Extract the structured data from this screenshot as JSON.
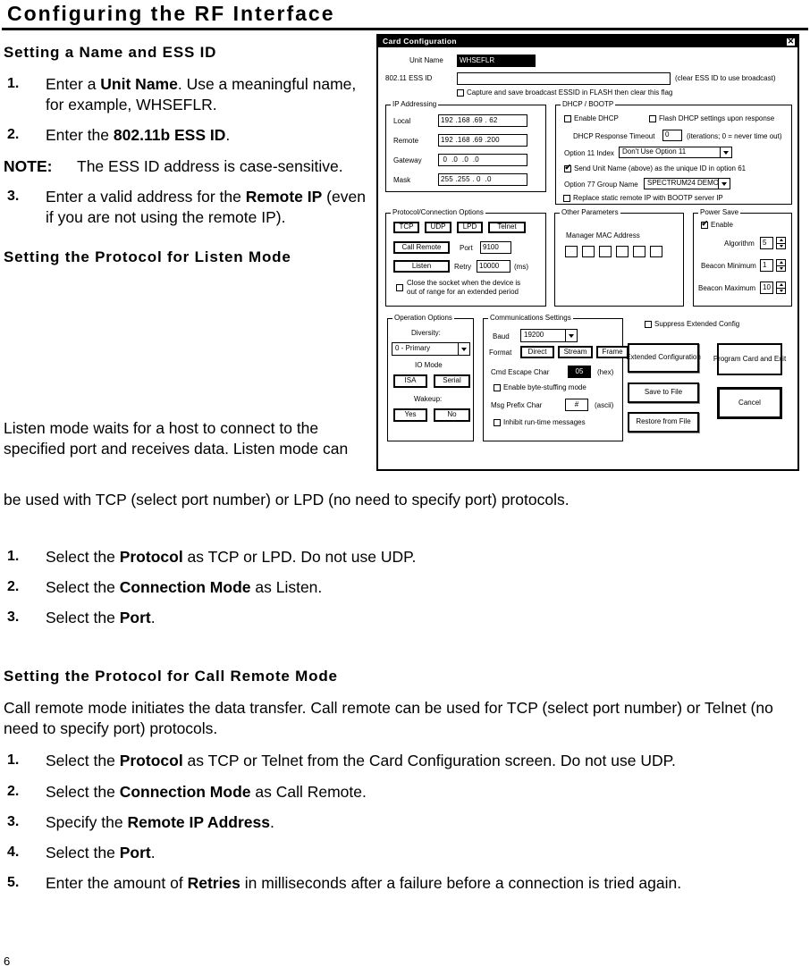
{
  "document": {
    "title": "Configuring the RF Interface",
    "page_number": "6"
  },
  "sections": [
    {
      "heading": "Setting a Name and ESS ID",
      "steps_html": [
        "Enter a <b>Unit Name</b>.  Use a meaningful name, for example, WHSEFLR.",
        "Enter the <b>802.11b ESS ID</b>."
      ],
      "note": {
        "label": "NOTE:",
        "text": "The ESS ID address is case-sensitive."
      },
      "steps_after_note_html": [
        "Enter a valid address for the <b>Remote IP</b> (even if you are not using the remote IP)."
      ]
    },
    {
      "heading": "Setting the Protocol for Listen Mode",
      "paragraph": "Listen mode waits for a host to connect to the specified port and receives data.  Listen mode can be used with TCP (select port number) or LPD (no need to specify port) protocols.",
      "steps_html": [
        "Select the <b>Protocol</b> as TCP or LPD.  Do not use UDP.",
        "Select the <b>Connection Mode</b> as Listen.",
        "Select the <b>Port</b>."
      ]
    },
    {
      "heading": "Setting the Protocol for Call Remote Mode",
      "paragraph": "Call remote mode initiates the data transfer.  Call remote can be used for TCP (select port number) or Telnet (no need to specify port) protocols.",
      "steps_html": [
        "Select the <b>Protocol</b> as TCP or Telnet from the Card Configuration screen.  Do not use UDP.",
        "Select the <b>Connection Mode</b> as Call Remote.",
        "Specify the <b>Remote IP Address</b>.",
        "Select the <b>Port</b>.",
        "Enter the amount of <b>Retries</b> in milliseconds after a failure before a connection is tried again."
      ]
    }
  ],
  "dialog": {
    "title": "Card Configuration",
    "close_label": "✕",
    "unit_name": {
      "label": "Unit Name",
      "value": "WHSEFLR"
    },
    "ess_id": {
      "label": "802.11 ESS ID",
      "value": "",
      "hint": "(clear ESS ID to use broadcast)",
      "capture_checkbox": {
        "label": "Capture and save broadcast ESSID in FLASH then clear this flag",
        "checked": false
      }
    },
    "ip_addressing": {
      "caption": "IP Addressing",
      "rows": [
        {
          "label": "Local",
          "octets": [
            "192",
            "168",
            "69",
            "62"
          ]
        },
        {
          "label": "Remote",
          "octets": [
            "192",
            "168",
            "69",
            "200"
          ]
        },
        {
          "label": "Gateway",
          "octets": [
            "0",
            "0",
            "0",
            "0"
          ]
        },
        {
          "label": "Mask",
          "octets": [
            "255",
            "255",
            "0",
            "0"
          ]
        }
      ]
    },
    "dhcp_bootp": {
      "caption": "DHCP / BOOTP",
      "enable_dhcp": {
        "label": "Enable DHCP",
        "checked": false
      },
      "flash_dhcp": {
        "label": "Flash DHCP settings upon response",
        "checked": false
      },
      "response_timeout": {
        "label": "DHCP Response Timeout",
        "value": "0",
        "suffix": "(iterations; 0 = never time out)"
      },
      "option11": {
        "label": "Option 11 Index",
        "value": "Don't Use Option 11"
      },
      "send_unit_name": {
        "label": "Send Unit Name (above) as the unique ID in option 61",
        "checked": true
      },
      "option77": {
        "label": "Option 77 Group Name",
        "value": "SPECTRUM24 DEMO"
      },
      "replace_static": {
        "label": "Replace static remote IP with BOOTP server IP",
        "checked": false
      }
    },
    "protocol_connection": {
      "caption": "Protocol/Connection Options",
      "protocols": [
        "TCP",
        "UDP",
        "LPD",
        "Telnet"
      ],
      "selected_protocol": "TCP",
      "mode_buttons": [
        "Call Remote",
        "Listen"
      ],
      "port": {
        "label": "Port",
        "value": "9100"
      },
      "retry": {
        "label": "Retry",
        "value": "10000",
        "units": "(ms)"
      },
      "close_socket": {
        "label": "Close the socket when the device is out of range for an extended period",
        "checked": false
      }
    },
    "other_parameters": {
      "caption": "Other Parameters",
      "mac_label": "Manager MAC Address",
      "mac_octets": [
        "",
        "",
        "",
        "",
        "",
        ""
      ]
    },
    "power_save": {
      "caption": "Power Save",
      "enable": {
        "label": "Enable",
        "checked": true
      },
      "fields": [
        {
          "label": "Algorithm",
          "value": "5"
        },
        {
          "label": "Beacon Minimum",
          "value": "1"
        },
        {
          "label": "Beacon Maximum",
          "value": "10"
        }
      ]
    },
    "operation_options": {
      "caption": "Operation Options",
      "diversity": {
        "label": "Diversity:",
        "value": "0 - Primary"
      },
      "io_mode": {
        "label": "IO Mode",
        "buttons": [
          "ISA",
          "Serial"
        ]
      },
      "wakeup": {
        "label": "Wakeup:",
        "buttons": [
          "Yes",
          "No"
        ]
      }
    },
    "communications_settings": {
      "caption": "Communications Settings",
      "baud": {
        "label": "Baud",
        "value": "19200"
      },
      "format": {
        "label": "Format",
        "buttons": [
          "Direct",
          "Stream",
          "Frame"
        ]
      },
      "cmd_escape_char": {
        "label": "Cmd Escape Char",
        "value": "05",
        "units": "(hex)"
      },
      "byte_stuffing": {
        "label": "Enable byte-stuffing mode",
        "checked": false
      },
      "msg_prefix_char": {
        "label": "Msg Prefix Char",
        "value": "#",
        "units": "(ascii)"
      },
      "inhibit_runtime": {
        "label": "Inhibit run-time messages",
        "checked": false
      }
    },
    "actions": {
      "suppress_extended_config": {
        "label": "Suppress Extended Config",
        "checked": false
      },
      "extended_configuration": "Extended Configuration",
      "save_to_file": "Save to File",
      "restore_from_file": "Restore from File",
      "program_card_and_exit": "Program Card and Exit",
      "cancel": "Cancel"
    }
  }
}
